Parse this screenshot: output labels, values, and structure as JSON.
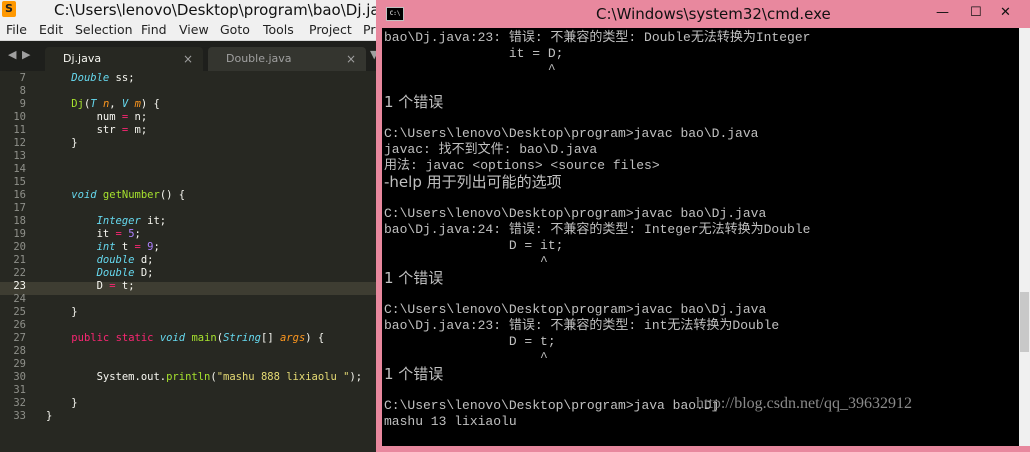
{
  "editor": {
    "app_icon": "sublime-text-icon",
    "title": "C:\\Users\\lenovo\\Desktop\\program\\bao\\Dj.ja",
    "menu": [
      "File",
      "Edit",
      "Selection",
      "Find",
      "View",
      "Goto",
      "Tools",
      "Project",
      "Pr"
    ],
    "tab_nav": [
      "◀",
      "▶",
      "▼"
    ],
    "tabs": [
      {
        "label": "Dj.java",
        "close": "×"
      },
      {
        "label": "Double.java",
        "close": "×"
      }
    ],
    "current_line": "23",
    "lines": [
      {
        "n": "7",
        "code": [
          {
            "t": "    "
          },
          {
            "t": "Double",
            "c": "ty"
          },
          {
            "t": " ss;"
          }
        ]
      },
      {
        "n": "8",
        "code": []
      },
      {
        "n": "9",
        "code": [
          {
            "t": "    "
          },
          {
            "t": "Dj",
            "c": "fn"
          },
          {
            "t": "("
          },
          {
            "t": "T",
            "c": "ty"
          },
          {
            "t": " "
          },
          {
            "t": "n",
            "c": "pa"
          },
          {
            "t": ", "
          },
          {
            "t": "V",
            "c": "ty"
          },
          {
            "t": " "
          },
          {
            "t": "m",
            "c": "pa"
          },
          {
            "t": ") {"
          }
        ]
      },
      {
        "n": "10",
        "code": [
          {
            "t": "        num "
          },
          {
            "t": "=",
            "c": "kw"
          },
          {
            "t": " n;"
          }
        ]
      },
      {
        "n": "11",
        "code": [
          {
            "t": "        str "
          },
          {
            "t": "=",
            "c": "kw"
          },
          {
            "t": " m;"
          }
        ]
      },
      {
        "n": "12",
        "code": [
          {
            "t": "    }"
          }
        ]
      },
      {
        "n": "13",
        "code": []
      },
      {
        "n": "14",
        "code": []
      },
      {
        "n": "15",
        "code": []
      },
      {
        "n": "16",
        "code": [
          {
            "t": "    "
          },
          {
            "t": "void",
            "c": "ty"
          },
          {
            "t": " "
          },
          {
            "t": "getNumber",
            "c": "fn"
          },
          {
            "t": "() {"
          }
        ]
      },
      {
        "n": "17",
        "code": []
      },
      {
        "n": "18",
        "code": [
          {
            "t": "        "
          },
          {
            "t": "Integer",
            "c": "ty"
          },
          {
            "t": " it;"
          }
        ]
      },
      {
        "n": "19",
        "code": [
          {
            "t": "        it "
          },
          {
            "t": "=",
            "c": "kw"
          },
          {
            "t": " "
          },
          {
            "t": "5",
            "c": "nu"
          },
          {
            "t": ";"
          }
        ]
      },
      {
        "n": "20",
        "code": [
          {
            "t": "        "
          },
          {
            "t": "int",
            "c": "ty"
          },
          {
            "t": " t "
          },
          {
            "t": "=",
            "c": "kw"
          },
          {
            "t": " "
          },
          {
            "t": "9",
            "c": "nu"
          },
          {
            "t": ";"
          }
        ]
      },
      {
        "n": "21",
        "code": [
          {
            "t": "        "
          },
          {
            "t": "double",
            "c": "ty"
          },
          {
            "t": " d;"
          }
        ]
      },
      {
        "n": "22",
        "code": [
          {
            "t": "        "
          },
          {
            "t": "Double",
            "c": "ty"
          },
          {
            "t": " D;"
          }
        ]
      },
      {
        "n": "23",
        "code": [
          {
            "t": "        D "
          },
          {
            "t": "=",
            "c": "kw"
          },
          {
            "t": " t;"
          }
        ]
      },
      {
        "n": "24",
        "code": []
      },
      {
        "n": "25",
        "code": [
          {
            "t": "    }"
          }
        ]
      },
      {
        "n": "26",
        "code": []
      },
      {
        "n": "27",
        "code": [
          {
            "t": "    "
          },
          {
            "t": "public",
            "c": "kw"
          },
          {
            "t": " "
          },
          {
            "t": "static",
            "c": "kw"
          },
          {
            "t": " "
          },
          {
            "t": "void",
            "c": "ty"
          },
          {
            "t": " "
          },
          {
            "t": "main",
            "c": "fn"
          },
          {
            "t": "("
          },
          {
            "t": "String",
            "c": "ty"
          },
          {
            "t": "[] "
          },
          {
            "t": "args",
            "c": "pa"
          },
          {
            "t": ") {"
          }
        ]
      },
      {
        "n": "28",
        "code": []
      },
      {
        "n": "29",
        "code": []
      },
      {
        "n": "30",
        "code": [
          {
            "t": "        System.out."
          },
          {
            "t": "println",
            "c": "fn"
          },
          {
            "t": "("
          },
          {
            "t": "\"mashu 888 lixiaolu \"",
            "c": "st"
          },
          {
            "t": ");"
          }
        ]
      },
      {
        "n": "31",
        "code": []
      },
      {
        "n": "32",
        "code": [
          {
            "t": "    }"
          }
        ]
      },
      {
        "n": "33",
        "code": [
          {
            "t": "}"
          }
        ]
      }
    ],
    "colors": {
      "background": "#272822",
      "keyword": "#f92672",
      "type": "#66d9ef",
      "function": "#a6e22e",
      "param": "#fd971f",
      "number": "#ae81ff",
      "string": "#e6db74"
    }
  },
  "cmd": {
    "icon": "cmd-window-icon",
    "icon_glyph": "C:\\",
    "title": "C:\\Windows\\system32\\cmd.exe",
    "min_glyph": "—",
    "max_glyph": "☐",
    "close_glyph": "✕",
    "border_color": "#e8889e",
    "lines": [
      {
        "t": "bao\\Dj.java:23: 错误: 不兼容的类型: Double无法转换为Integer",
        "big": false
      },
      {
        "t": "                it = D;",
        "big": false
      },
      {
        "t": "                     ^",
        "big": false
      },
      {
        "t": "",
        "big": false
      },
      {
        "t": "1 个错误",
        "big": true
      },
      {
        "t": "",
        "big": false
      },
      {
        "t": "C:\\Users\\lenovo\\Desktop\\program>javac bao\\D.java",
        "big": false
      },
      {
        "t": "javac: 找不到文件: bao\\D.java",
        "big": false
      },
      {
        "t": "用法: javac <options> <source files>",
        "big": false
      },
      {
        "t": "-help 用于列出可能的选项",
        "big": true
      },
      {
        "t": "",
        "big": false
      },
      {
        "t": "C:\\Users\\lenovo\\Desktop\\program>javac bao\\Dj.java",
        "big": false
      },
      {
        "t": "bao\\Dj.java:24: 错误: 不兼容的类型: Integer无法转换为Double",
        "big": false
      },
      {
        "t": "                D = it;",
        "big": false
      },
      {
        "t": "                    ^",
        "big": false
      },
      {
        "t": "1 个错误",
        "big": true
      },
      {
        "t": "",
        "big": false
      },
      {
        "t": "C:\\Users\\lenovo\\Desktop\\program>javac bao\\Dj.java",
        "big": false
      },
      {
        "t": "bao\\Dj.java:23: 错误: 不兼容的类型: int无法转换为Double",
        "big": false
      },
      {
        "t": "                D = t;",
        "big": false
      },
      {
        "t": "                    ^",
        "big": false
      },
      {
        "t": "1 个错误",
        "big": true
      },
      {
        "t": "",
        "big": false
      },
      {
        "t": "C:\\Users\\lenovo\\Desktop\\program>java bao.Dj",
        "big": false
      },
      {
        "t": "mashu 13 lixiaolu",
        "big": false
      },
      {
        "t": "",
        "big": false
      },
      {
        "t": "C:\\Users\\lenovo\\Desktop\\program>",
        "big": false
      }
    ],
    "watermark": "http://blog.csdn.net/qq_39632912"
  }
}
